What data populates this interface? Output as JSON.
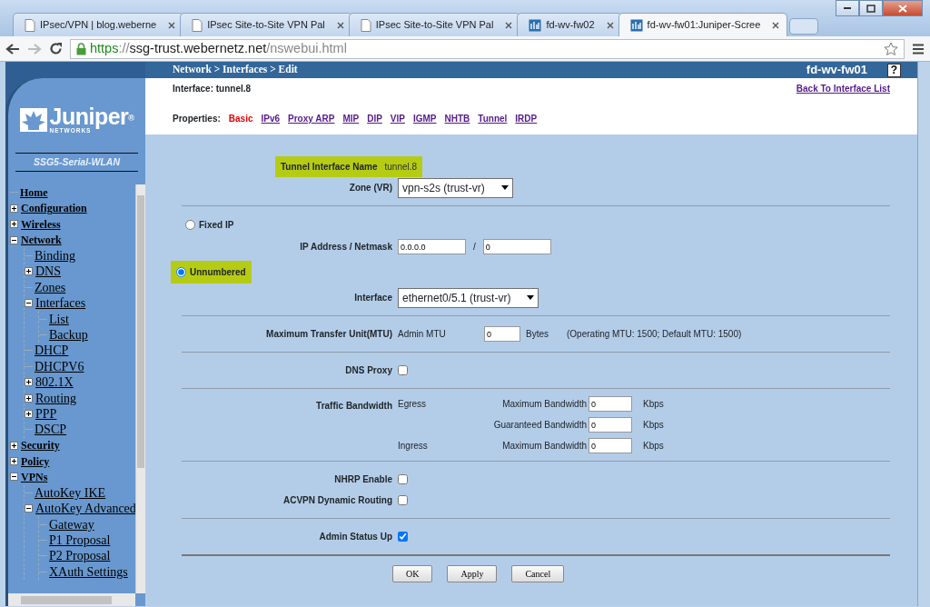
{
  "browser": {
    "tabs": [
      {
        "title": "IPsec/VPN | blog.weberne",
        "kind": "page",
        "selected": false
      },
      {
        "title": "IPsec Site-to-Site VPN Pal",
        "kind": "page",
        "selected": false
      },
      {
        "title": "IPsec Site-to-Site VPN Pal",
        "kind": "page",
        "selected": false
      },
      {
        "title": "fd-wv-fw02",
        "kind": "device",
        "selected": false
      },
      {
        "title": "fd-wv-fw01:Juniper-Scree",
        "kind": "device",
        "selected": true
      }
    ],
    "url": {
      "scheme": "https",
      "separator": "://",
      "host": "ssg-trust.webernetz.net",
      "path": "/nswebui.html"
    }
  },
  "sidebar": {
    "logo": {
      "name": "Juniper$^{®}$",
      "tagline": "NETWORKS"
    },
    "model": "SSG5-Serial-WLAN",
    "tree": [
      {
        "label": "Home"
      },
      {
        "label": "Configuration",
        "expanded": false
      },
      {
        "label": "Wireless",
        "expanded": false
      },
      {
        "label": "Network",
        "expanded": true,
        "children": [
          {
            "label": "Binding"
          },
          {
            "label": "DNS",
            "expanded": false
          },
          {
            "label": "Zones"
          },
          {
            "label": "Interfaces",
            "expanded": true,
            "children": [
              {
                "label": "List"
              },
              {
                "label": "Backup"
              }
            ]
          },
          {
            "label": "DHCP"
          },
          {
            "label": "DHCPV6"
          },
          {
            "label": "802.1X",
            "expanded": false
          },
          {
            "label": "Routing",
            "expanded": false
          },
          {
            "label": "PPP",
            "expanded": false
          },
          {
            "label": "DSCP"
          }
        ]
      },
      {
        "label": "Security",
        "expanded": false
      },
      {
        "label": "Policy",
        "expanded": false
      },
      {
        "label": "VPNs",
        "expanded": true,
        "children": [
          {
            "label": "AutoKey IKE"
          },
          {
            "label": "AutoKey Advanced",
            "expanded": true,
            "children": [
              {
                "label": "Gateway"
              },
              {
                "label": "P1 Proposal"
              },
              {
                "label": "P2 Proposal"
              },
              {
                "label": "XAuth Settings"
              }
            ]
          }
        ]
      }
    ]
  },
  "header": {
    "breadcrumb": "Network > Interfaces > Edit",
    "device": "fd-wv-fw01",
    "help": "?"
  },
  "interface": "Interface: tunnel.8",
  "back_link": "Back To Interface List",
  "properties": {
    "label": "Properties:",
    "links": [
      {
        "label": "Basic",
        "selected": true
      },
      {
        "label": "IPv6",
        "selected": false
      },
      {
        "label": "Proxy ARP",
        "selected": false
      },
      {
        "label": "MIP",
        "selected": false
      },
      {
        "label": "DIP",
        "selected": false
      },
      {
        "label": "VIP",
        "selected": false
      },
      {
        "label": "IGMP",
        "selected": false
      },
      {
        "label": "NHTB",
        "selected": false
      },
      {
        "label": "Tunnel",
        "selected": false
      },
      {
        "label": "IRDP",
        "selected": false
      }
    ]
  },
  "form": {
    "sections": [
      {
        "rows": [
          {
            "kind": "text",
            "label": "Tunnel Interface Name",
            "value": "tunnel.8",
            "highlighted": true
          },
          {
            "kind": "select",
            "label": "Zone (VR)",
            "value": "vpn-s2s (trust-vr)"
          }
        ]
      },
      {
        "rows": [
          {
            "kind": "radio",
            "label": "Fixed IP",
            "selected": false,
            "highlighted": false
          },
          {
            "kind": "ip",
            "label": "IP Address / Netmask",
            "address": "0.0.0.0",
            "separator": "/",
            "netmask": "0"
          },
          {
            "kind": "radio",
            "label": "Unnumbered",
            "selected": true,
            "highlighted": true
          },
          {
            "kind": "select",
            "label": "Interface",
            "value": "ethernet0/5.1 (trust-vr)"
          }
        ]
      },
      {
        "rows": [
          {
            "kind": "mtu",
            "label": "Maximum Transfer Unit(MTU)",
            "sublabel": "Admin MTU",
            "value": "0",
            "unit": "Bytes",
            "note": "(Operating MTU: 1500; Default MTU: 1500)"
          }
        ]
      },
      {
        "rows": [
          {
            "kind": "checkbox",
            "label": "DNS Proxy",
            "checked": false
          }
        ]
      },
      {
        "rows": [
          {
            "kind": "bandwidth",
            "label": "Traffic Bandwidth",
            "lines": [
              {
                "direction": "Egress",
                "label": "Maximum Bandwidth",
                "value": "0",
                "unit": "Kbps"
              },
              {
                "label": "Guaranteed Bandwidth",
                "value": "0",
                "unit": "Kbps"
              },
              {
                "direction": "Ingress",
                "label": "Maximum Bandwidth",
                "value": "0",
                "unit": "Kbps"
              }
            ]
          }
        ]
      },
      {
        "rows": [
          {
            "kind": "checkbox",
            "label": "NHRP Enable",
            "checked": false
          },
          {
            "kind": "checkbox",
            "label": "ACVPN Dynamic Routing",
            "checked": false
          }
        ]
      },
      {
        "rows": [
          {
            "kind": "checkbox",
            "label": "Admin Status Up",
            "checked": true
          }
        ]
      }
    ],
    "buttons": [
      "OK",
      "Apply",
      "Cancel"
    ]
  }
}
